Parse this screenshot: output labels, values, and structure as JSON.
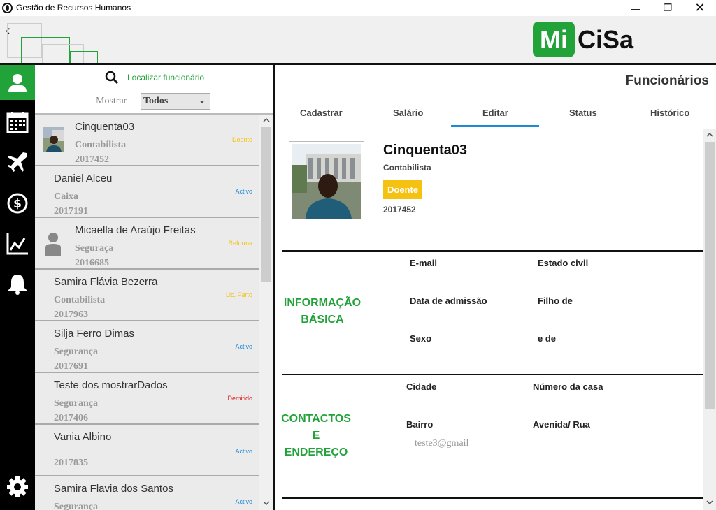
{
  "window": {
    "title": "Gestão de Recursos Humanos"
  },
  "header": {
    "logo_part1": "Mi",
    "logo_part2": "CiSa"
  },
  "list": {
    "search_label": "Localizar funcionário",
    "show_label": "Mostrar",
    "show_value": "Todos",
    "items": [
      {
        "name": "Cinquenta03",
        "role": "Contabilista",
        "number": "2017452",
        "status": "Doente",
        "status_color": "#f5c211",
        "has_photo": true
      },
      {
        "name": "Daniel Alceu",
        "role": "Caixa",
        "number": "2017191",
        "status": "Activo",
        "status_color": "#1e8ad6"
      },
      {
        "name": "Micaella de Araújo Freitas",
        "role": "Seguraça",
        "number": "2016685",
        "status": "Reforma",
        "status_color": "#f5c211",
        "has_avatar": true
      },
      {
        "name": "Samira Flávia Bezerra",
        "role": "Contabilista",
        "number": "2017963",
        "status": "Lic. Parto",
        "status_color": "#f5c211"
      },
      {
        "name": "Silja Ferro Dimas",
        "role": "Segurança",
        "number": "2017691",
        "status": "Activo",
        "status_color": "#1e8ad6"
      },
      {
        "name": "Teste dos mostrarDados",
        "role": "Segurança",
        "number": "2017406",
        "status": "Demitido",
        "status_color": "#e21b1b"
      },
      {
        "name": "Vania Albino",
        "role": "",
        "number": "2017835",
        "status": "Activo",
        "status_color": "#1e8ad6"
      },
      {
        "name": "Samira Flavia dos Santos",
        "role": "Segurança",
        "number": "",
        "status": "Activo",
        "status_color": "#1e8ad6"
      }
    ]
  },
  "main": {
    "title": "Funcionários",
    "tabs": [
      "Cadastrar",
      "Salário",
      "Editar",
      "Status",
      "Histórico"
    ],
    "active_tab": "Editar",
    "profile": {
      "name": "Cinquenta03",
      "role": "Contabilista",
      "status": "Doente",
      "number": "2017452"
    },
    "basic": {
      "heading_line1": "INFORMAÇÃO",
      "heading_line2": "BÁSICA",
      "email": "E-mail",
      "civil": "Estado civil",
      "admission": "Data de admissão",
      "father": "Filho de",
      "sex": "Sexo",
      "mother": "e de"
    },
    "contacts": {
      "heading_line1": "CONTACTOS",
      "heading_line2": "E",
      "heading_line3": "ENDEREÇO",
      "city": "Cidade",
      "house": "Número da casa",
      "district": "Bairro",
      "street": "Avenida/ Rua",
      "email_value": "teste3@gmail"
    }
  },
  "colors": {
    "accent": "#22a33a",
    "tab_underline": "#1e8ad6",
    "badge": "#f5c211"
  }
}
